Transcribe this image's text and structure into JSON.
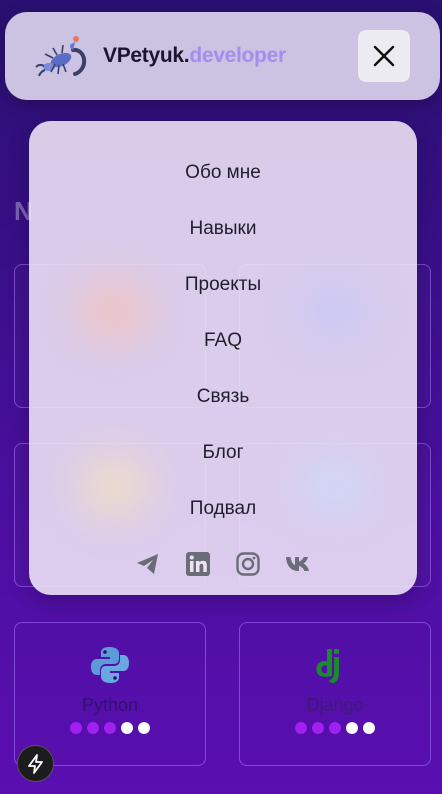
{
  "header": {
    "brand_main": "VPetyuk.",
    "brand_accent": "developer"
  },
  "menu": {
    "items": [
      {
        "label": "Обо мне"
      },
      {
        "label": "Навыки"
      },
      {
        "label": "Проекты"
      },
      {
        "label": "FAQ"
      },
      {
        "label": "Связь"
      },
      {
        "label": "Блог"
      },
      {
        "label": "Подвал"
      }
    ],
    "socials": [
      "telegram-icon",
      "linkedin-icon",
      "instagram-icon",
      "vk-icon"
    ]
  },
  "skills": [
    {
      "name": "Python",
      "level": "3 of 5"
    },
    {
      "name": "Django",
      "level": "3 of 5"
    }
  ],
  "colors": {
    "accent": "#a58cf0",
    "dot_active": "#a020f0",
    "background": "#3a0f8a"
  }
}
